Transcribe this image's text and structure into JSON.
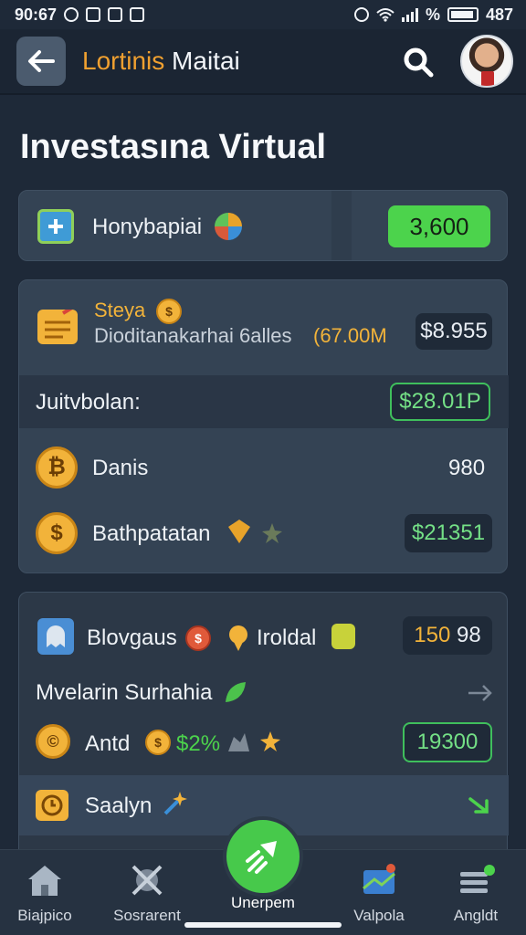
{
  "status_bar": {
    "time": "90:67",
    "battery_level": "487",
    "percent_sign": "%"
  },
  "app_bar": {
    "title_accent": "Lortinis",
    "title_rest": " Maitai",
    "back_icon": "back-arrow-icon",
    "search_icon": "search-icon"
  },
  "page": {
    "title": "Investasına Virtual"
  },
  "card1": {
    "label": "Honybapiai",
    "value": "3,600"
  },
  "card2": {
    "title": "Steya",
    "subtitle": "Dioditanakarhai 6alles",
    "subtitle_amount": "(67.00M",
    "subtitle_value": "$8.955",
    "band_label": "Juitvbolan:",
    "band_value": "$28.01P",
    "rows": [
      {
        "label": "Danis",
        "value": "980"
      },
      {
        "label": "Bathpatatan",
        "value": "$21351"
      }
    ]
  },
  "card3": {
    "row1_label": "Blovgaus",
    "row1_label2": "Iroldal",
    "row1_value": "150",
    "row1_value2": "98",
    "row2_label": "Mvelarin Surhahia",
    "row3_label": "Antd",
    "row3_percent": "$2%",
    "row3_value": "19300",
    "row4_label": "Saalyn"
  },
  "bottom_nav": {
    "items": [
      {
        "label": "Biajpico",
        "icon": "home-icon"
      },
      {
        "label": "Sosrarent",
        "icon": "tools-icon"
      },
      {
        "label": "Unerpem",
        "icon": "rocket-icon"
      },
      {
        "label": "Valpola",
        "icon": "map-icon"
      },
      {
        "label": "Angldt",
        "icon": "menu-icon"
      }
    ]
  },
  "colors": {
    "background": "#1e2938",
    "card": "#344354",
    "accent_green": "#4cd34c",
    "accent_orange": "#f0a030"
  }
}
